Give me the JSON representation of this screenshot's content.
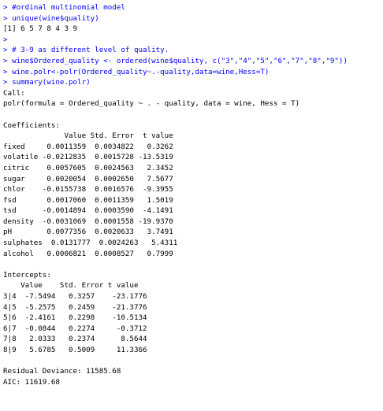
{
  "console": {
    "lines": [
      {
        "kind": "cmd",
        "text": "> #ordinal multinomial model"
      },
      {
        "kind": "cmd",
        "text": "> unique(wine$quality)"
      },
      {
        "kind": "out",
        "text": "[1] 6 5 7 8 4 3 9"
      },
      {
        "kind": "cmd",
        "text": ">"
      },
      {
        "kind": "cmd",
        "text": "> # 3-9 as different level of quality."
      },
      {
        "kind": "cmd",
        "text": "> wine$Ordered_quality <- ordered(wine$quality, c(\"3\",\"4\",\"5\",\"6\",\"7\",\"8\",\"9\"))"
      },
      {
        "kind": "cmd",
        "text": "> wine.polr<-polr(Ordered_quality~.-quality,data=wine,Hess=T)"
      },
      {
        "kind": "cmd",
        "text": "> summary(wine.polr)"
      },
      {
        "kind": "out",
        "text": "Call:"
      },
      {
        "kind": "out",
        "text": "polr(formula = Ordered_quality ~ . - quality, data = wine, Hess = T)"
      },
      {
        "kind": "out",
        "text": ""
      },
      {
        "kind": "out",
        "text": "Coefficients:"
      },
      {
        "kind": "out",
        "text": "              Value Std. Error  t value"
      },
      {
        "kind": "out",
        "text": "fixed     0.0011359  0.0034822   0.3262"
      },
      {
        "kind": "out",
        "text": "volatile -0.0212835  0.0015728 -13.5319"
      },
      {
        "kind": "out",
        "text": "citric    0.0057605  0.0024563   2.3452"
      },
      {
        "kind": "out",
        "text": "sugar     0.0020054  0.0002650   7.5677"
      },
      {
        "kind": "out",
        "text": "chlor    -0.0155738  0.0016576  -9.3955"
      },
      {
        "kind": "out",
        "text": "fsd       0.0017060  0.0011359   1.5019"
      },
      {
        "kind": "out",
        "text": "tsd      -0.0014894  0.0003590  -4.1491"
      },
      {
        "kind": "out",
        "text": "density  -0.0031069  0.0001558 -19.9370"
      },
      {
        "kind": "out",
        "text": "pH        0.0077356  0.0020633   3.7491"
      },
      {
        "kind": "out",
        "text": "sulphates  0.0131777  0.0024263   5.4311"
      },
      {
        "kind": "out",
        "text": "alcohol   0.0006821  0.0008527   0.7999"
      },
      {
        "kind": "out",
        "text": ""
      },
      {
        "kind": "out",
        "text": "Intercepts:"
      },
      {
        "kind": "out",
        "text": "    Value    Std. Error t value"
      },
      {
        "kind": "out",
        "text": "3|4  -7.5494   0.3257    -23.1776"
      },
      {
        "kind": "out",
        "text": "4|5  -5.2575   0.2459    -21.3776"
      },
      {
        "kind": "out",
        "text": "5|6  -2.4161   0.2298    -10.5134"
      },
      {
        "kind": "out",
        "text": "6|7  -0.0844   0.2274     -0.3712"
      },
      {
        "kind": "out",
        "text": "7|8   2.0333   0.2374      8.5644"
      },
      {
        "kind": "out",
        "text": "8|9   5.6785   0.5009     11.3366"
      },
      {
        "kind": "out",
        "text": ""
      },
      {
        "kind": "out",
        "text": "Residual Deviance: 11585.68"
      },
      {
        "kind": "out",
        "text": "AIC: 11619.68"
      }
    ]
  }
}
